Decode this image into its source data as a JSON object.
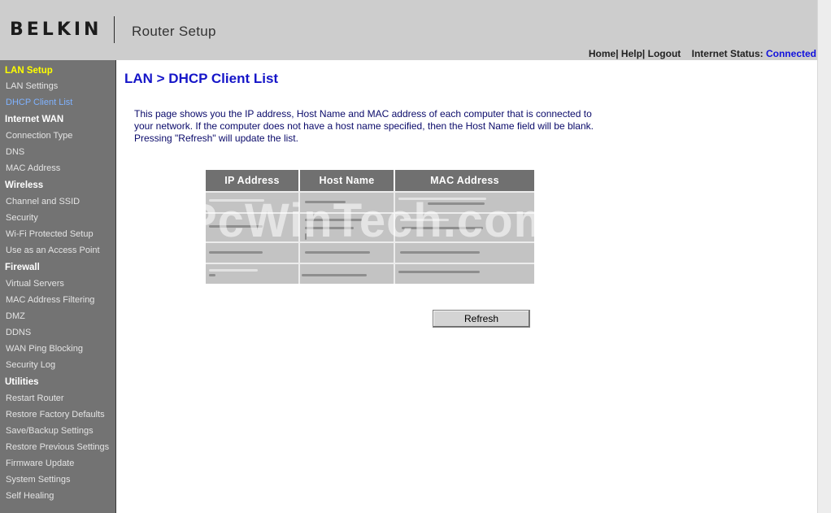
{
  "header": {
    "logo_text": "BELKIN",
    "title": "Router Setup",
    "links": [
      {
        "label": "Home"
      },
      {
        "label": "Help"
      },
      {
        "label": "Logout"
      }
    ],
    "separator": "|",
    "status_label": "Internet Status:",
    "status_value": "Connected",
    "status_color": "#1111dd"
  },
  "sidebar": {
    "groups": [
      {
        "heading": "LAN Setup",
        "items": [
          "LAN Settings",
          "DHCP Client List"
        ]
      },
      {
        "heading": "Internet WAN",
        "items": [
          "Connection Type",
          "DNS",
          "MAC Address"
        ]
      },
      {
        "heading": "Wireless",
        "items": [
          "Channel and SSID",
          "Security",
          "Wi-Fi Protected Setup",
          "Use as an Access Point"
        ]
      },
      {
        "heading": "Firewall",
        "items": [
          "Virtual Servers",
          "MAC Address Filtering",
          "DMZ",
          "DDNS",
          "WAN Ping Blocking",
          "Security Log"
        ]
      },
      {
        "heading": "Utilities",
        "items": [
          "Restart Router",
          "Restore Factory Defaults",
          "Save/Backup Settings",
          "Restore Previous Settings",
          "Firmware Update",
          "System Settings",
          "Self Healing"
        ]
      }
    ],
    "active_group": "LAN Setup",
    "active_item": "DHCP Client List",
    "colors": {
      "background": "#737373",
      "active_heading": "#ffff00",
      "active_item": "#7fb2ff"
    }
  },
  "main": {
    "heading": "LAN > DHCP Client List",
    "intro_lines": [
      "This page shows you the IP address, Host Name and MAC address of each computer that is connected to",
      "your network. If the computer does not have a host name specified, then the Host Name field will be blank.",
      "Pressing \"Refresh\" will update the list."
    ],
    "table": {
      "columns": [
        "IP Address",
        "Host Name",
        "MAC Address"
      ],
      "rows_note_redacted": true,
      "row_count": 4
    },
    "watermark": "PcWinTech.com",
    "refresh_label": "Refresh"
  }
}
